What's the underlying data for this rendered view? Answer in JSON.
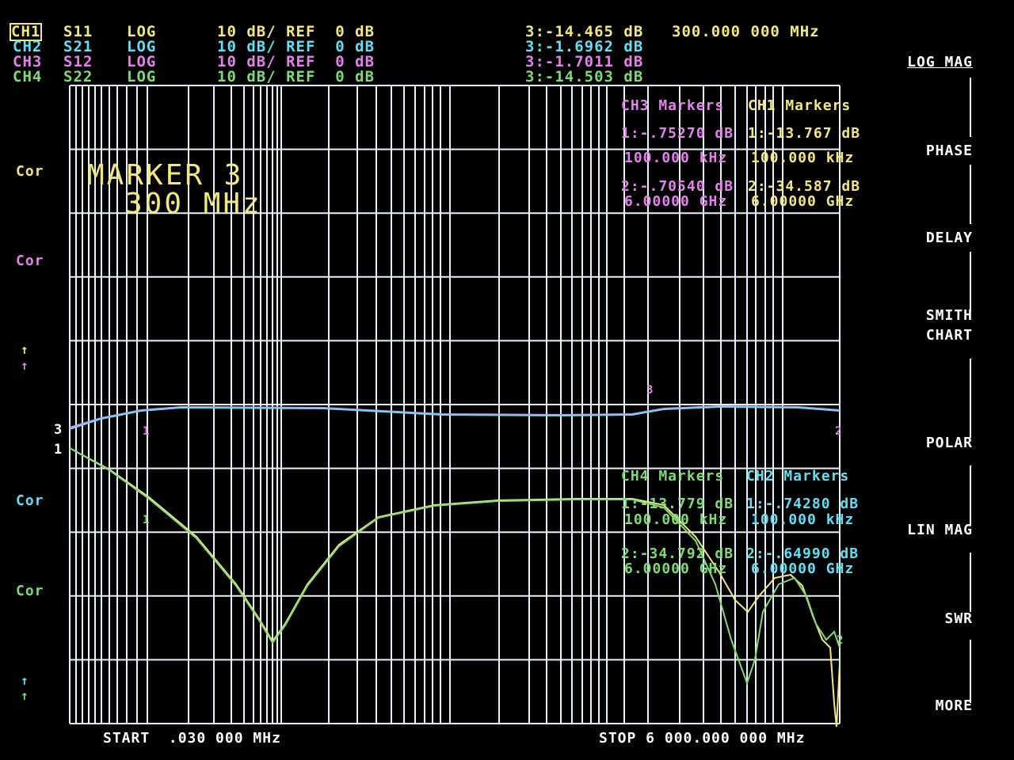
{
  "header": {
    "channels": [
      {
        "ch": "CH1",
        "param": "S11",
        "fmt": "LOG",
        "scale": "10 dB/ REF  0 dB",
        "marker": "3:-14.465 dB",
        "color": "#f4e87c"
      },
      {
        "ch": "CH2",
        "param": "S21",
        "fmt": "LOG",
        "scale": "10 dB/ REF  0 dB",
        "marker": "3:-1.6962 dB",
        "color": "#5fe0f4"
      },
      {
        "ch": "CH3",
        "param": "S12",
        "fmt": "LOG",
        "scale": "10 dB/ REF  0 dB",
        "marker": "3:-1.7011 dB",
        "color": "#e680ec"
      },
      {
        "ch": "CH4",
        "param": "S22",
        "fmt": "LOG",
        "scale": "10 dB/ REF  0 dB",
        "marker": "3:-14.503 dB",
        "color": "#7edc74"
      }
    ],
    "marker_freq": "300.000 000 MHz"
  },
  "left_labels": {
    "cor": "Cor",
    "ref_arrow": "↑",
    "ref_marker": "▭",
    "trace_num_3": "3",
    "trace_num_1": "1"
  },
  "annotation": {
    "line1": "MARKER 3",
    "line2": "300 MHz"
  },
  "marker_tables": {
    "ch3": {
      "title": "CH3 Markers",
      "m1_val": "1:-.75270 dB",
      "m1_freq": "100.000 kHz",
      "m2_val": "2:-.70540 dB",
      "m2_freq": "6.00000 GHz"
    },
    "ch1": {
      "title": "CH1 Markers",
      "m1_val": "1:-13.767 dB",
      "m1_freq": "100.000 kHz",
      "m2_val": "2:-34.587 dB",
      "m2_freq": "6.00000 GHz"
    },
    "ch4": {
      "title": "CH4 Markers",
      "m1_val": "1:-13.779 dB",
      "m1_freq": "100.000 kHz",
      "m2_val": "2:-34.792 dB",
      "m2_freq": "6.00000 GHz"
    },
    "ch2": {
      "title": "CH2 Markers",
      "m1_val": "1:-.74280 dB",
      "m1_freq": "100.000 kHz",
      "m2_val": "2:-.64990 dB",
      "m2_freq": "6.00000 GHz"
    }
  },
  "footer": {
    "start": "START  .030 000 MHz",
    "stop": "STOP 6 000.000 000 MHz"
  },
  "softkeys": [
    "LOG MAG",
    "PHASE",
    "DELAY",
    "SMITH",
    "CHART",
    "POLAR",
    "LIN MAG",
    "SWR",
    "MORE"
  ],
  "trace_markers": {
    "m1": "1",
    "m2": "2",
    "m3": "3"
  },
  "colors": {
    "ch1": "#f4e87c",
    "ch2": "#5fe0f4",
    "ch3": "#e680ec",
    "ch4": "#7edc74",
    "grid": "#e8f2ff"
  }
}
